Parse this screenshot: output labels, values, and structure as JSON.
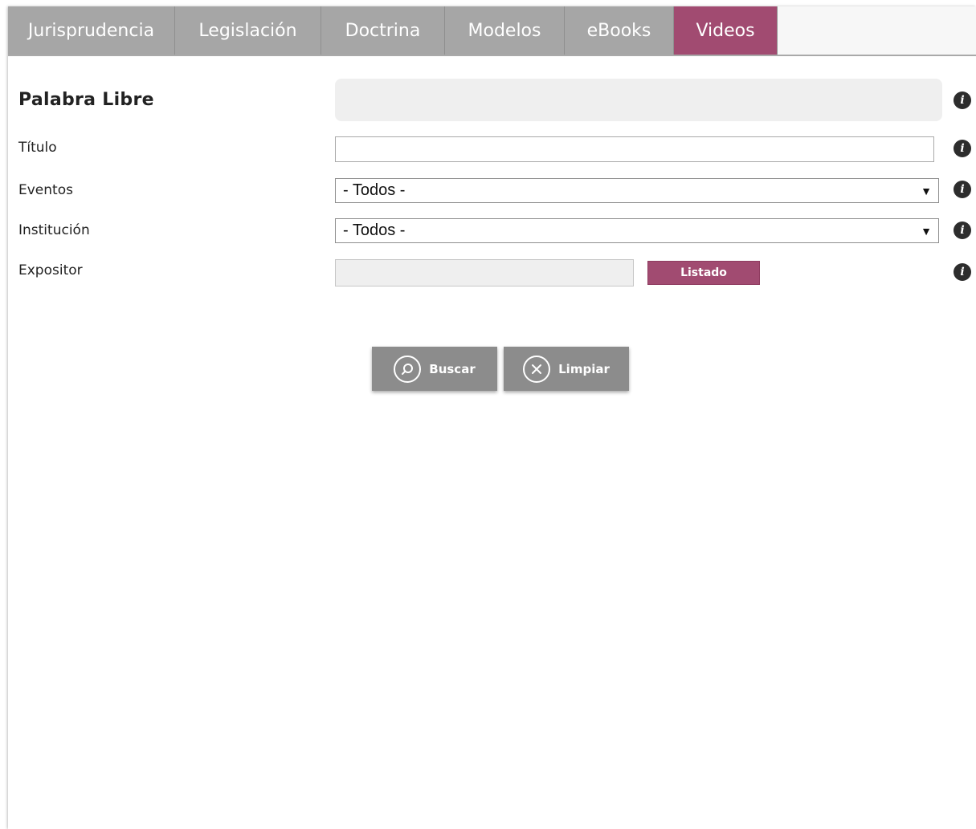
{
  "tabs": [
    {
      "label": "Jurisprudencia",
      "active": false
    },
    {
      "label": "Legislación",
      "active": false
    },
    {
      "label": "Doctrina",
      "active": false
    },
    {
      "label": "Modelos",
      "active": false
    },
    {
      "label": "eBooks",
      "active": false
    },
    {
      "label": "Videos",
      "active": true
    }
  ],
  "form": {
    "free_word": {
      "label": "Palabra Libre",
      "value": ""
    },
    "title": {
      "label": "Título",
      "value": ""
    },
    "events": {
      "label": "Eventos",
      "selected": "- Todos -"
    },
    "institution": {
      "label": "Institución",
      "selected": "- Todos -"
    },
    "speaker": {
      "label": "Expositor",
      "value": "",
      "list_button": "Listado"
    }
  },
  "actions": {
    "search_label": "Buscar",
    "clear_label": "Limpiar"
  },
  "colors": {
    "tab_default": "#a6a6a6",
    "accent": "#a14b71",
    "action_button": "#8c8c8c"
  },
  "icons": {
    "info": "info-icon",
    "search": "search-icon",
    "clear": "close-circle-icon",
    "dropdown": "chevron-down-icon"
  }
}
